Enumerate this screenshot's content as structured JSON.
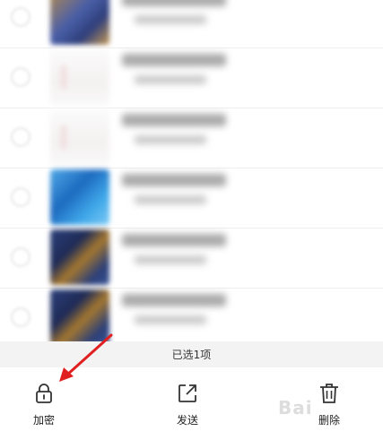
{
  "files": [
    {
      "thumb": "game-screenshot"
    },
    {
      "thumb": "document-image"
    },
    {
      "thumb": "document-image"
    },
    {
      "thumb": "blue-app-screenshot"
    },
    {
      "thumb": "dark-game-screenshot"
    },
    {
      "thumb": "dark-game-screenshot"
    }
  ],
  "status": {
    "selected_text": "已选1项"
  },
  "actions": {
    "encrypt": {
      "label": "加密",
      "icon": "lock-icon"
    },
    "send": {
      "label": "发送",
      "icon": "share-icon"
    },
    "delete": {
      "label": "删除",
      "icon": "trash-icon"
    }
  },
  "annotation": {
    "arrow_color": "#e02020"
  },
  "watermark": {
    "text": "Bai"
  }
}
